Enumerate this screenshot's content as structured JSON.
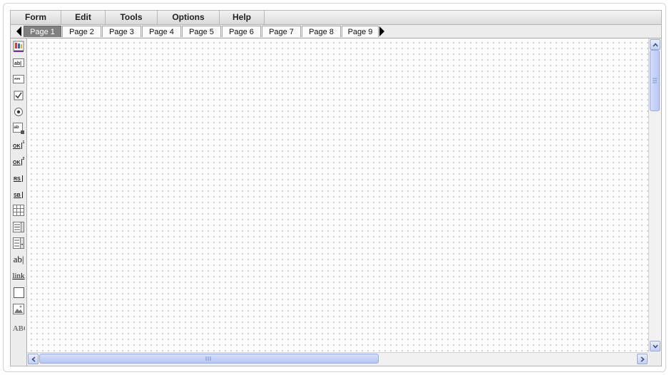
{
  "menubar": {
    "items": [
      {
        "label": "Form"
      },
      {
        "label": "Edit"
      },
      {
        "label": "Tools"
      },
      {
        "label": "Options"
      },
      {
        "label": "Help"
      }
    ]
  },
  "tabs": {
    "active_index": 0,
    "items": [
      {
        "label": "Page 1"
      },
      {
        "label": "Page 2"
      },
      {
        "label": "Page 3"
      },
      {
        "label": "Page 4"
      },
      {
        "label": "Page 5"
      },
      {
        "label": "Page 6"
      },
      {
        "label": "Page 7"
      },
      {
        "label": "Page 8"
      },
      {
        "label": "Page 9"
      }
    ]
  },
  "toolbox": {
    "items": [
      {
        "icon": "pointer-select-icon"
      },
      {
        "icon": "text-field-icon",
        "text": "ab|"
      },
      {
        "icon": "password-field-icon",
        "text": "***"
      },
      {
        "icon": "checkbox-icon"
      },
      {
        "icon": "radio-button-icon"
      },
      {
        "icon": "textarea-icon"
      },
      {
        "icon": "ok-button-1-icon",
        "text": "OK",
        "sup": "1"
      },
      {
        "icon": "ok-button-2-icon",
        "text": "OK",
        "sup": "2"
      },
      {
        "icon": "reset-button-icon",
        "text": "RS"
      },
      {
        "icon": "submit-button-icon",
        "text": "SB"
      },
      {
        "icon": "grid-table-icon"
      },
      {
        "icon": "list-box-icon"
      },
      {
        "icon": "combo-box-icon"
      },
      {
        "icon": "label-text-icon",
        "text": "ab|"
      },
      {
        "icon": "link-icon",
        "text": "link"
      },
      {
        "icon": "rectangle-icon"
      },
      {
        "icon": "image-icon"
      },
      {
        "icon": "spell-check-icon",
        "text": "ABC"
      }
    ]
  },
  "colors": {
    "active_tab": "#808080",
    "scroll_accent": "#c2d0f4",
    "canvas_dot": "#8e8e8e"
  }
}
